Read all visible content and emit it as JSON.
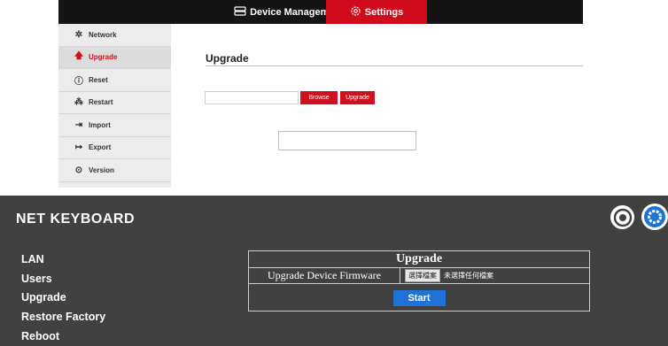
{
  "top_panel": {
    "tabs": [
      {
        "label": "Device Management",
        "icon": "server-icon"
      },
      {
        "label": "Settings",
        "icon": "gear-icon"
      }
    ],
    "active_tab": "Settings",
    "sidebar": [
      {
        "label": "Network",
        "icon": "network-icon"
      },
      {
        "label": "Upgrade",
        "icon": "arrow-up-icon"
      },
      {
        "label": "Reset",
        "icon": "reset-icon"
      },
      {
        "label": "Restart",
        "icon": "restart-icon"
      },
      {
        "label": "Import",
        "icon": "import-icon"
      },
      {
        "label": "Export",
        "icon": "export-icon"
      },
      {
        "label": "Version",
        "icon": "version-icon"
      }
    ],
    "active_item": "Upgrade",
    "page_title": "Upgrade",
    "file_path_value": "",
    "browse_label": "Browse",
    "upgrade_label": "Upgrade",
    "progress": 0,
    "accent_color": "#cf0a1a"
  },
  "bottom_panel": {
    "app_title": "NET KEYBOARD",
    "nav": [
      "LAN",
      "Users",
      "Upgrade",
      "Restore Factory",
      "Reboot"
    ],
    "table_title": "Upgrade",
    "row_label": "Upgrade Device Firmware",
    "choose_file_label": "選擇檔案",
    "no_file_text": "未選擇任何檔案",
    "start_label": "Start",
    "icons": [
      "eye-icon",
      "gear-icon"
    ],
    "accent_color": "#1e73d6"
  }
}
